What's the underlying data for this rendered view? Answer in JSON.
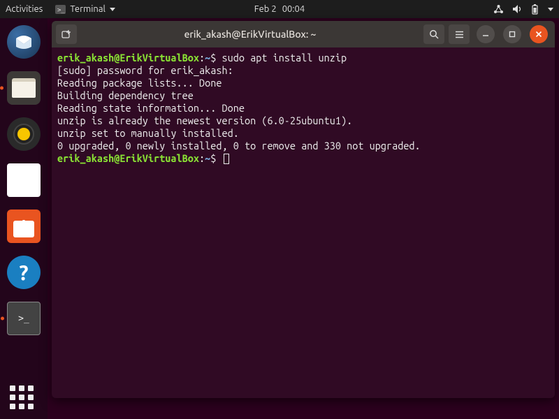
{
  "topbar": {
    "activities": "Activities",
    "app_name": "Terminal",
    "date": "Feb 2",
    "time": "00:04"
  },
  "window": {
    "title": "erik_akash@ErikVirtualBox: ~"
  },
  "terminal": {
    "prompt_user": "erik_akash@ErikVirtualBox",
    "prompt_path": "~",
    "command1": "sudo apt install unzip",
    "lines": [
      "[sudo] password for erik_akash:",
      "Reading package lists... Done",
      "Building dependency tree",
      "Reading state information... Done",
      "unzip is already the newest version (6.0-25ubuntu1).",
      "unzip set to manually installed.",
      "0 upgraded, 0 newly installed, 0 to remove and 330 not upgraded."
    ]
  }
}
